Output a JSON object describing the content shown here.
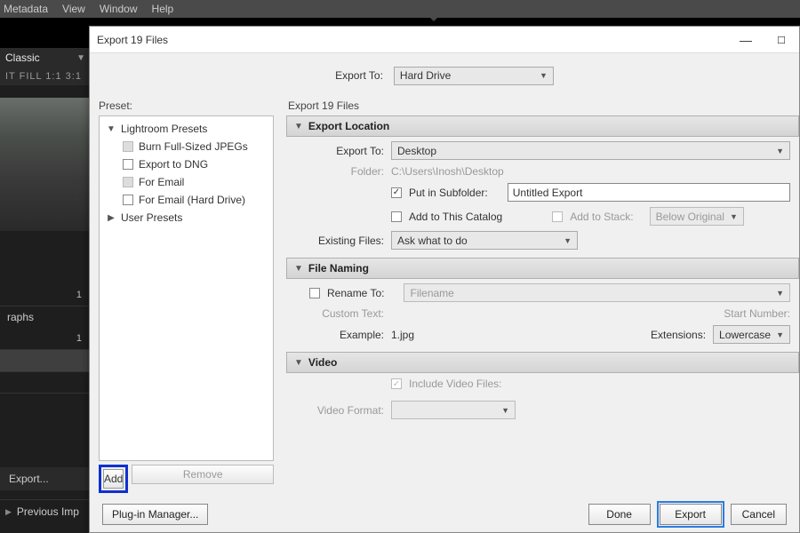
{
  "menubar": [
    "Metadata",
    "View",
    "Window",
    "Help"
  ],
  "left": {
    "brand": "Classic",
    "ratios": "IT   FILL   1:1   3:1",
    "num1": "1",
    "graphs": "raphs",
    "num2": "1",
    "export": "Export...",
    "prev": "Previous Imp"
  },
  "dialog": {
    "title": "Export 19 Files",
    "export_to_label": "Export To:",
    "export_to_value": "Hard Drive"
  },
  "preset": {
    "label": "Preset:",
    "groups": [
      {
        "expanded": true,
        "label": "Lightroom Presets"
      },
      {
        "expanded": false,
        "label": "User Presets"
      }
    ],
    "items": [
      {
        "box": "gray",
        "label": "Burn Full-Sized JPEGs"
      },
      {
        "box": "empty",
        "label": "Export to DNG"
      },
      {
        "box": "gray",
        "label": "For Email"
      },
      {
        "box": "empty",
        "label": "For Email (Hard Drive)"
      }
    ],
    "add": "Add",
    "remove": "Remove"
  },
  "right": {
    "head": "Export 19 Files",
    "sec1": {
      "title": "Export Location",
      "export_to_lbl": "Export To:",
      "export_to_val": "Desktop",
      "folder_lbl": "Folder:",
      "folder_val": "C:\\Users\\Inosh\\Desktop",
      "subfolder_lbl": "Put in Subfolder:",
      "subfolder_val": "Untitled Export",
      "add_catalog": "Add to This Catalog",
      "add_stack": "Add to Stack:",
      "below_orig": "Below Original",
      "existing_lbl": "Existing Files:",
      "existing_val": "Ask what to do"
    },
    "sec2": {
      "title": "File Naming",
      "rename_lbl": "Rename To:",
      "rename_val": "Filename",
      "custom_lbl": "Custom Text:",
      "startnum_lbl": "Start Number:",
      "example_lbl": "Example:",
      "example_val": "1.jpg",
      "ext_lbl": "Extensions:",
      "ext_val": "Lowercase"
    },
    "sec3": {
      "title": "Video",
      "include": "Include Video Files:",
      "vformat_lbl": "Video Format:"
    }
  },
  "bottom": {
    "plugmgr": "Plug-in Manager...",
    "done": "Done",
    "export": "Export",
    "cancel": "Cancel"
  }
}
